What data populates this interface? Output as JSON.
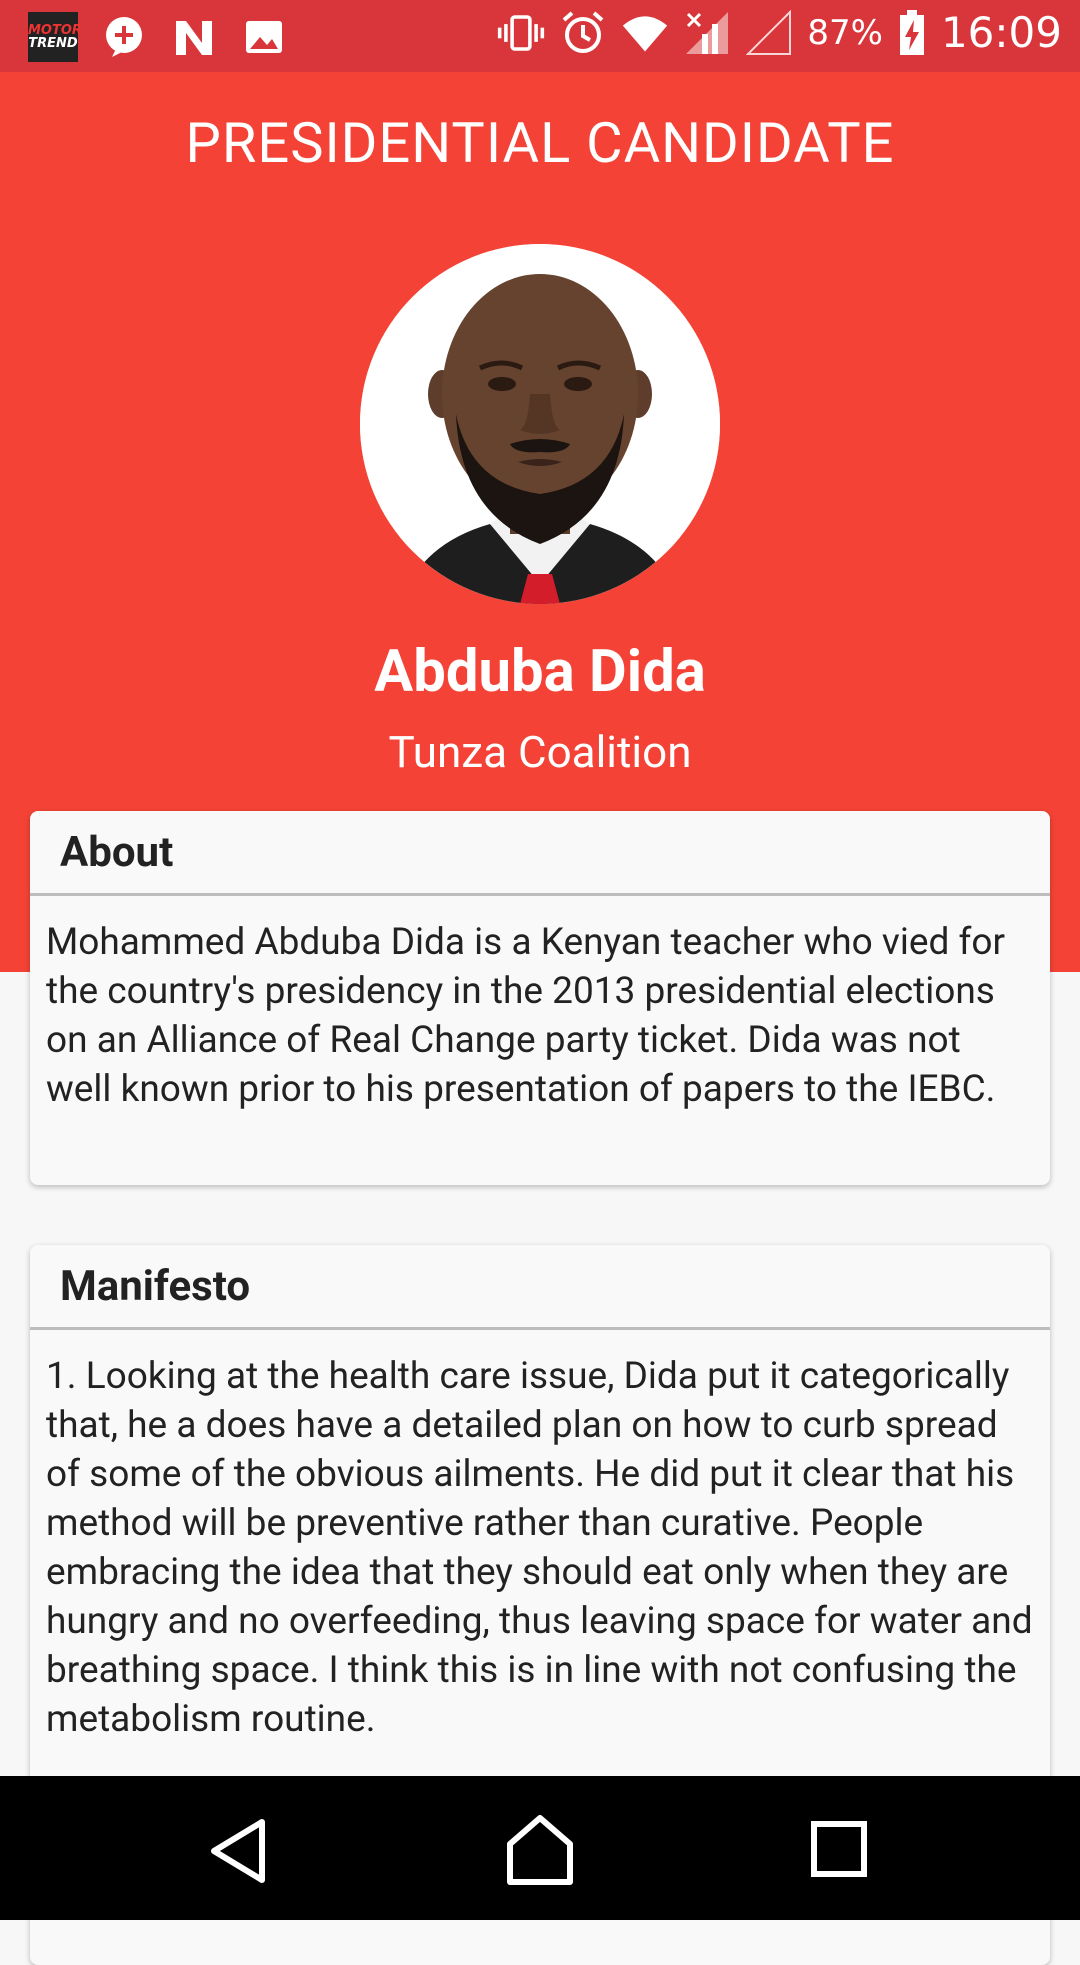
{
  "status_bar": {
    "battery_percent": "87%",
    "time": "16:09",
    "icons": [
      "motor-trend-app-icon",
      "add-notification-icon",
      "n-app-icon",
      "image-icon",
      "vibrate-icon",
      "alarm-icon",
      "wifi-icon",
      "signal-x-icon",
      "signal-empty-icon",
      "battery-charging-icon"
    ],
    "motor_trend_text_top": "MOTOR",
    "motor_trend_text_bottom": "TREND"
  },
  "header": {
    "title": "PRESIDENTIAL CANDIDATE",
    "name": "Abduba Dida",
    "party": "Tunza Coalition",
    "background_color": "#f44336"
  },
  "about": {
    "heading": "About",
    "text": "Mohammed Abduba Dida is a Kenyan teacher who vied for the country's presidency in the 2013 presidential elections on an Alliance of Real Change party ticket. Dida was not well known prior to his presentation of papers to the IEBC."
  },
  "manifesto": {
    "heading": "Manifesto",
    "text": "1.  Looking at the health care issue, Dida put it categorically that, he a does have a detailed plan on how to curb spread of some of the obvious ailments.  He did put it clear that his method will be preventive rather than curative. People embracing the idea that they should eat only when they are hungry and no overfeeding, thus leaving space for water and breathing space. I think this is in line with not confusing the metabolism routine."
  },
  "nav": {
    "icons": [
      "back-icon",
      "home-icon",
      "recents-icon"
    ]
  }
}
